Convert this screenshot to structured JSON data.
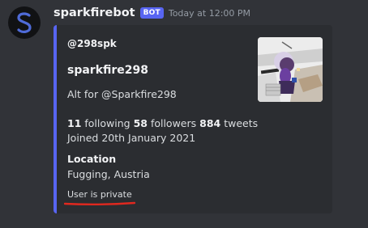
{
  "message": {
    "username": "sparkfirebot",
    "bot_tag": "BOT",
    "timestamp": "Today at 12:00 PM"
  },
  "embed": {
    "author": "@298spk",
    "title": "sparkfire298",
    "description": "Alt for @Sparkfire298",
    "stats": {
      "following_count": "11",
      "following_label": " following ",
      "followers_count": "58",
      "followers_label": " followers ",
      "tweets_count": "884",
      "tweets_label": " tweets"
    },
    "joined": "Joined 20th January 2021",
    "field": {
      "name": "Location",
      "value": "Fugging, Austria"
    },
    "footer": "User is private"
  },
  "colors": {
    "background": "#313338",
    "embed_background": "#2b2d31",
    "accent": "#5865f2",
    "annotation": "#e0281f"
  },
  "icons": {
    "avatar": "letter-s-logo-icon"
  }
}
